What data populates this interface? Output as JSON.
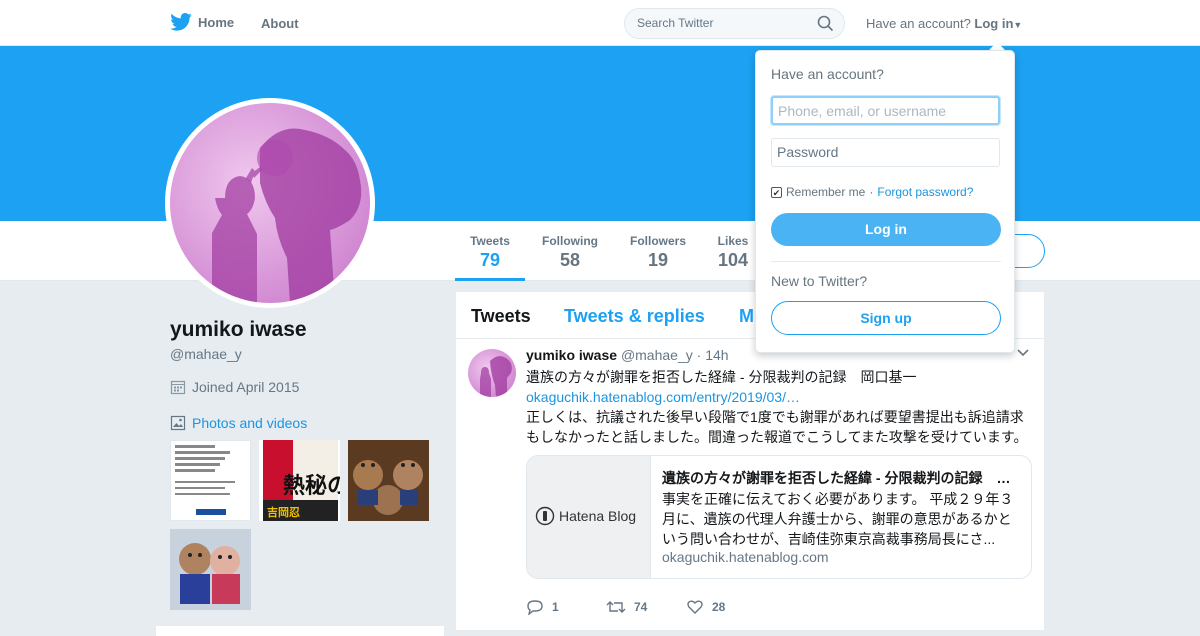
{
  "topbar": {
    "home_label": "Home",
    "about_label": "About",
    "search_placeholder": "Search Twitter",
    "have_account": "Have an account?",
    "login_label": "Log in"
  },
  "profile": {
    "name": "yumiko iwase",
    "handle": "@mahae_y",
    "joined": "Joined April 2015",
    "photos_label": "Photos and videos"
  },
  "stats": [
    {
      "label": "Tweets",
      "value": "79"
    },
    {
      "label": "Following",
      "value": "58"
    },
    {
      "label": "Followers",
      "value": "19"
    },
    {
      "label": "Likes",
      "value": "104"
    }
  ],
  "thumbs": {
    "t2_text": "熱秘の",
    "t2_sub": "吉岡忍"
  },
  "timeline": {
    "tabs": [
      "Tweets",
      "Tweets & replies",
      "M"
    ],
    "tweet": {
      "name": "yumiko iwase",
      "handle": "@mahae_y",
      "time": "· 14h",
      "line1": "遺族の方々が謝罪を拒否した経緯 - 分限裁判の記録　岡口基一",
      "link": "okaguchik.hatenablog.com/entry/2019/03/…",
      "line2": "正しくは、抗議された後早い段階で1度でも謝罪があれば要望書提出も訴追請求もしなかったと話しました。間違った報道でこうしてまた攻撃を受けています。",
      "card_brand": "Hatena Blog",
      "card_title": "遺族の方々が謝罪を拒否した経緯 - 分限裁判の記録　岡口基一",
      "card_desc": "事実を正確に伝えておく必要があります。 平成２９年３月に、遺族の代理人弁護士から、謝罪の意思があるかという問い合わせが、吉崎佳弥東京高裁事務局長にさ...",
      "card_domain": "okaguchik.hatenablog.com",
      "replies": "1",
      "retweets": "74",
      "likes": "28"
    }
  },
  "dropdown": {
    "title": "Have an account?",
    "username_placeholder": "Phone, email, or username",
    "password_placeholder": "Password",
    "remember": "Remember me",
    "separator": "·",
    "forgot": "Forgot password?",
    "login_button": "Log in",
    "new_label": "New to Twitter?",
    "signup_button": "Sign up"
  },
  "colors": {
    "accent": "#1da1f2",
    "banner": "#1da1f2",
    "background": "#e6ecf0"
  }
}
